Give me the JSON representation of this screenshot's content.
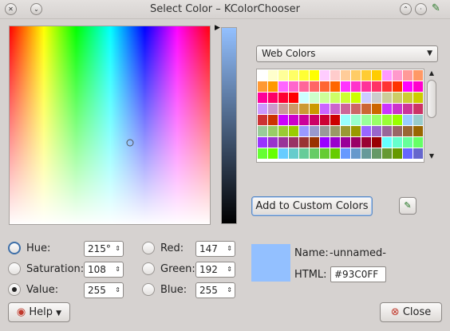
{
  "window": {
    "title": "Select Color – KColorChooser"
  },
  "titlebar_icons": {
    "menu": "chevron-down-icon",
    "help": "question-icon",
    "keep_above": "chevrons-up-icon",
    "minimize": "dot-icon",
    "picker": "eyedropper-icon"
  },
  "picker": {
    "selected_color": "#93C0FF",
    "marker_hint": "hue-sat-marker"
  },
  "palette": {
    "selected": "Web Colors",
    "colors": [
      "#FFFFFF",
      "#FFFFCC",
      "#FFFF99",
      "#FFFF66",
      "#FFFF33",
      "#FFFF00",
      "#FFCCFF",
      "#FFCCCC",
      "#FFCC99",
      "#FFCC66",
      "#FFCC33",
      "#FFCC00",
      "#FF99FF",
      "#FF99CC",
      "#FF9999",
      "#FF9966",
      "#FF9933",
      "#FF9900",
      "#FF66FF",
      "#FF66CC",
      "#FF6699",
      "#FF6666",
      "#FF6633",
      "#FF6600",
      "#FF33FF",
      "#FF33CC",
      "#FF3399",
      "#FF3366",
      "#FF3333",
      "#FF3300",
      "#FF00FF",
      "#FF00CC",
      "#FF0099",
      "#FF0066",
      "#FF0033",
      "#FF0000",
      "#CCFFFF",
      "#CCFFCC",
      "#CCFF99",
      "#CCFF66",
      "#CCFF33",
      "#CCFF00",
      "#CCCCFF",
      "#CCCCCC",
      "#CCCC99",
      "#CCCC66",
      "#CCCC33",
      "#CCCC00",
      "#CC99FF",
      "#CC99CC",
      "#CC9999",
      "#CC9966",
      "#CC9933",
      "#CC9900",
      "#CC66FF",
      "#CC66CC",
      "#CC6699",
      "#CC6666",
      "#CC6633",
      "#CC6600",
      "#CC33FF",
      "#CC33CC",
      "#CC3399",
      "#CC3366",
      "#CC3333",
      "#CC3300",
      "#CC00FF",
      "#CC00CC",
      "#CC0099",
      "#CC0066",
      "#CC0033",
      "#CC0000",
      "#99FFFF",
      "#99FFCC",
      "#99FF99",
      "#99FF66",
      "#99FF33",
      "#99FF00",
      "#99CCFF",
      "#99CCCC",
      "#99CC99",
      "#99CC66",
      "#99CC33",
      "#99CC00",
      "#9999FF",
      "#9999CC",
      "#999999",
      "#999966",
      "#999933",
      "#999900",
      "#9966FF",
      "#9966CC",
      "#996699",
      "#996666",
      "#996633",
      "#996600",
      "#9933FF",
      "#9933CC",
      "#993399",
      "#993366",
      "#993333",
      "#993300",
      "#9900FF",
      "#9900CC",
      "#990099",
      "#990066",
      "#990033",
      "#990000",
      "#66FFFF",
      "#66FFCC",
      "#66FF99",
      "#66FF66",
      "#66FF33",
      "#66FF00",
      "#66CCFF",
      "#66CCCC",
      "#66CC99",
      "#66CC66",
      "#66CC33",
      "#66CC00",
      "#6699FF",
      "#6699CC",
      "#669999",
      "#669966",
      "#669933",
      "#669900",
      "#6666FF",
      "#6666CC"
    ]
  },
  "buttons": {
    "add_custom": "Add to Custom Colors",
    "help": "Help",
    "close": "Close"
  },
  "hsv": {
    "hue": {
      "label": "Hue:",
      "value": "215°"
    },
    "saturation": {
      "label": "Saturation:",
      "value": "108"
    },
    "value": {
      "label": "Value:",
      "value": "255"
    }
  },
  "rgb": {
    "red": {
      "label": "Red:",
      "value": "147"
    },
    "green": {
      "label": "Green:",
      "value": "192"
    },
    "blue": {
      "label": "Blue:",
      "value": "255"
    }
  },
  "info": {
    "name_label": "Name:",
    "name_value": "-unnamed-",
    "html_label": "HTML:",
    "html_value": "#93C0FF"
  }
}
